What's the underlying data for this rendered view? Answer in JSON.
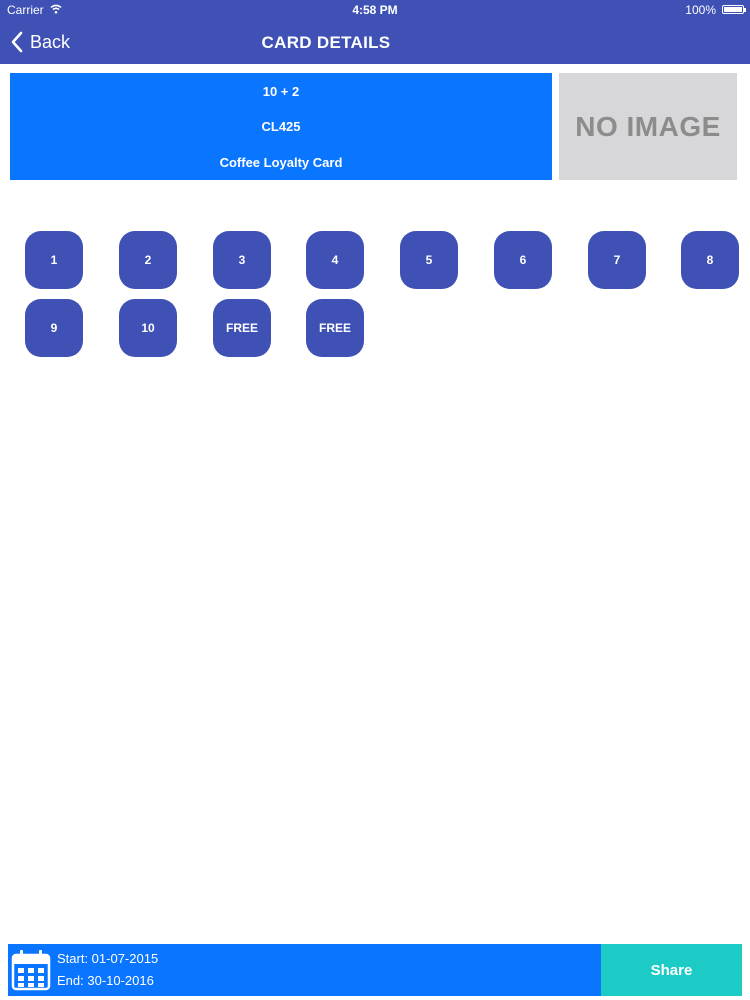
{
  "status_bar": {
    "carrier": "Carrier",
    "time": "4:58 PM",
    "battery": "100%"
  },
  "header": {
    "back_label": "Back",
    "title": "CARD DETAILS"
  },
  "card": {
    "offer": "10 + 2",
    "code": "CL425",
    "name": "Coffee Loyalty Card",
    "image_placeholder": "NO IMAGE"
  },
  "stamps": [
    "1",
    "2",
    "3",
    "4",
    "5",
    "6",
    "7",
    "8",
    "9",
    "10",
    "FREE",
    "FREE"
  ],
  "footer": {
    "start": "Start: 01-07-2015",
    "end": "End: 30-10-2016",
    "share_label": "Share"
  },
  "colors": {
    "header": "#3f51b5",
    "card": "#0a75ff",
    "stamp": "#3f51b5",
    "share": "#1ccbc6",
    "placeholder": "#d7d7d9"
  },
  "icons": {
    "back": "chevron-left-icon",
    "wifi": "wifi-icon",
    "battery": "battery-icon",
    "calendar": "calendar-icon"
  }
}
